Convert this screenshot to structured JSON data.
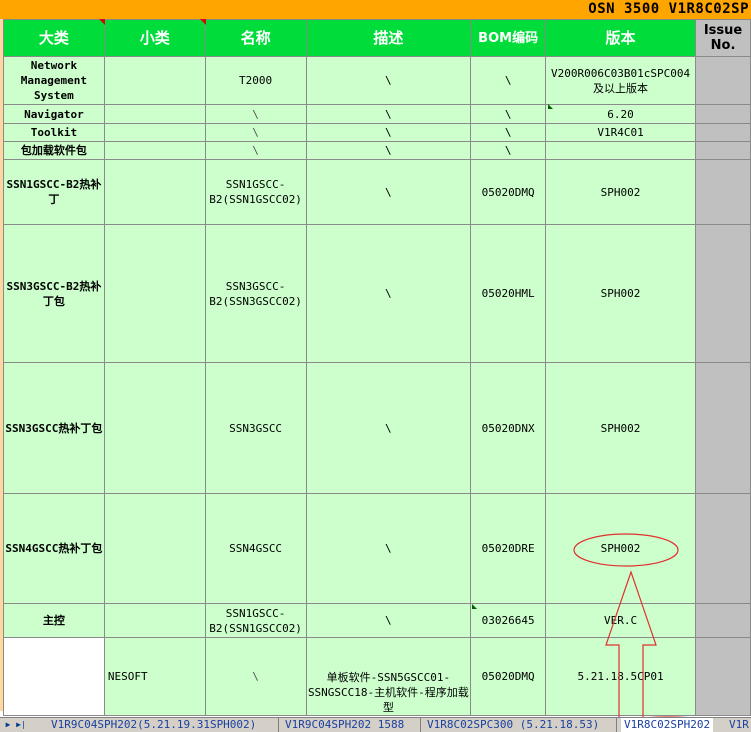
{
  "banner": {
    "title": "OSN 3500 V1R8C02SP"
  },
  "headers": {
    "category": "大类",
    "subcategory": "小类",
    "name": "名称",
    "description": "描述",
    "bom": "BOM编码",
    "version": "版本",
    "issue": "Issue No."
  },
  "rows": [
    {
      "category": "Network Management System",
      "sub": "",
      "name": "T2000",
      "desc": "\\",
      "bom": "\\",
      "version": "V200R006C03B01cSPC004及以上版本"
    },
    {
      "category": "Navigator",
      "sub": "",
      "name": "\\",
      "desc": "\\",
      "bom": "\\",
      "version": "6.20"
    },
    {
      "category": "Toolkit",
      "sub": "",
      "name": "\\",
      "desc": "\\",
      "bom": "\\",
      "version": "V1R4C01"
    },
    {
      "category": "包加载软件包",
      "sub": "",
      "name": "\\",
      "desc": "\\",
      "bom": "\\",
      "version": ""
    },
    {
      "category": "SSN1GSCC-B2热补丁",
      "sub": "",
      "name": "SSN1GSCC-B2(SSN1GSCC02)",
      "desc": "\\",
      "bom": "05020DMQ",
      "version": "SPH002"
    },
    {
      "category": "SSN3GSCC-B2热补丁包",
      "sub": "",
      "name": "SSN3GSCC-B2(SSN3GSCC02)",
      "desc": "\\",
      "bom": "05020HML",
      "version": "SPH002"
    },
    {
      "category": "SSN3GSCC热补丁包",
      "sub": "",
      "name": "SSN3GSCC",
      "desc": "\\",
      "bom": "05020DNX",
      "version": "SPH002"
    },
    {
      "category": "SSN4GSCC热补丁包",
      "sub": "",
      "name": "SSN4GSCC",
      "desc": "\\",
      "bom": "05020DRE",
      "version": "SPH002"
    },
    {
      "category": "主控",
      "sub": "",
      "name": "SSN1GSCC-B2(SSN1GSCC02)",
      "desc": "\\",
      "bom": "03026645",
      "version": "VER.C"
    },
    {
      "category": "",
      "sub": "NESOFT",
      "name": "\\",
      "desc": "单板软件-SSN5GSCC01-SSNGSCC18-主机软件-程序加载型",
      "bom": "05020DMQ",
      "version": "5.21.18.5CP01"
    }
  ],
  "tabs": [
    {
      "label": "V1R9C04SPH202(5.21.19.31SPH002)",
      "active": false
    },
    {
      "label": "V1R9C04SPH202 1588",
      "active": false
    },
    {
      "label": "V1R8C02SPC300 (5.21.18.53)",
      "active": false
    },
    {
      "label": "V1R8C02SPH202",
      "active": true
    },
    {
      "label": "V1R",
      "active": false
    }
  ],
  "nav": {
    "next": "▶",
    "last": "▶|"
  },
  "colors": {
    "banner": "#ffa500",
    "header_bg": "#00dd3a",
    "cell_green": "#ccffcc",
    "issue_gray": "#c0c0c0",
    "annotation": "#e03030"
  }
}
